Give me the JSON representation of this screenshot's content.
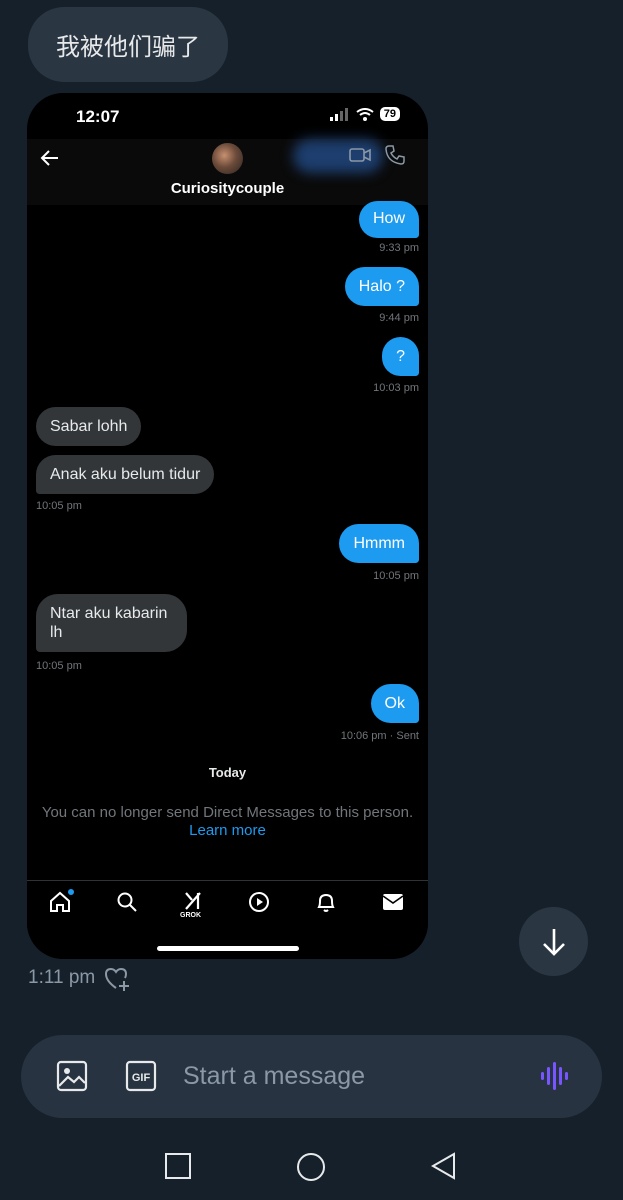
{
  "top_message": {
    "text": "我被他们骗了"
  },
  "screenshot": {
    "status_bar": {
      "time": "12:07",
      "battery": "79"
    },
    "header": {
      "contact_name": "Curiositycouple"
    },
    "messages": [
      {
        "direction": "out",
        "text": "How",
        "time": "9:33 pm"
      },
      {
        "direction": "out",
        "text": "Halo ?",
        "time": "9:44 pm"
      },
      {
        "direction": "out",
        "text": "?",
        "time": "10:03 pm"
      },
      {
        "direction": "in",
        "text": "Sabar lohh",
        "time": ""
      },
      {
        "direction": "in",
        "text": "Anak aku belum tidur",
        "time": "10:05 pm"
      },
      {
        "direction": "out",
        "text": "Hmmm",
        "time": "10:05 pm"
      },
      {
        "direction": "in",
        "text": "Ntar aku kabarin lh",
        "time": "10:05 pm"
      },
      {
        "direction": "out",
        "text": "Ok",
        "time": "10:06 pm · Sent"
      }
    ],
    "day_divider": "Today",
    "notice": "You can no longer send Direct Messages to this person.",
    "learn_more": "Learn more",
    "nav": {
      "grok_label": "GROK"
    }
  },
  "message_meta": {
    "time": "1:11 pm"
  },
  "composer": {
    "placeholder": "Start a message",
    "gif_label": "GIF"
  },
  "colors": {
    "background": "#15202b",
    "accent": "#1d9bf0",
    "bubble_in": "#333639",
    "voice": "#7856ff"
  }
}
